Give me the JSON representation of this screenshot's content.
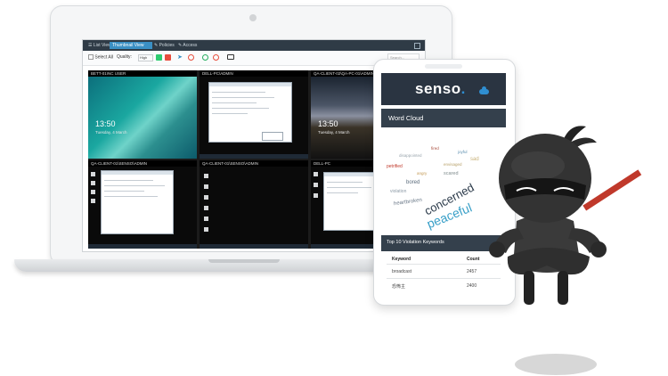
{
  "app": {
    "tabs": [
      {
        "label": "☰ List View"
      },
      {
        "label": "Thumbnail View"
      },
      {
        "label": "✎ Policies"
      },
      {
        "label": "✎ Access"
      }
    ],
    "toolbar": {
      "select_all": "Select All",
      "quality_label": "Quality:",
      "quality_value": "High",
      "search_placeholder": "Search..."
    },
    "tiles": [
      {
        "label": "BETT-01\\NC USER",
        "lock_time": "13:50",
        "lock_date": "Tuesday, 4 March"
      },
      {
        "label": "DELL-PC\\ADMIN"
      },
      {
        "label": "QA-CLIENT-02\\QA-PC-01\\ADMIN",
        "lock_time": "13:50",
        "lock_date": "Tuesday, 4 March"
      },
      {
        "label": "QA-CLIENT-01\\SENSO\\ADMIN"
      },
      {
        "label": "QA-CLIENT-01\\SENSO\\ADMIN"
      },
      {
        "label": "DELL-PC"
      }
    ]
  },
  "phone": {
    "brand": "senso",
    "brand_dot": ".",
    "word_cloud_title": "Word Cloud",
    "words": [
      {
        "text": "concerned",
        "color": "#2b3a4a"
      },
      {
        "text": "peaceful",
        "color": "#3aa0c8"
      },
      {
        "text": "petrified",
        "color": "#c0392b"
      },
      {
        "text": "bored",
        "color": "#5a6b7b"
      },
      {
        "text": "scared",
        "color": "#7f8c8d"
      },
      {
        "text": "heartbroken",
        "color": "#6d7b8a"
      },
      {
        "text": "envisaged",
        "color": "#b8a26b"
      },
      {
        "text": "violation",
        "color": "#8e9ba7"
      },
      {
        "text": "disappointed",
        "color": "#9aa5ad"
      },
      {
        "text": "sad",
        "color": "#c8b27a"
      },
      {
        "text": "joyful",
        "color": "#5d8fb0"
      },
      {
        "text": "fired",
        "color": "#a84c3c"
      },
      {
        "text": "angry",
        "color": "#c49a55"
      }
    ],
    "violation_title": "Top 10 Violation Keywords",
    "table": {
      "col_keyword": "Keyword",
      "col_count": "Count",
      "rows": [
        {
          "keyword": "broadcast",
          "count": "2457"
        },
        {
          "keyword": "恐怖主",
          "count": "2400"
        }
      ]
    }
  }
}
